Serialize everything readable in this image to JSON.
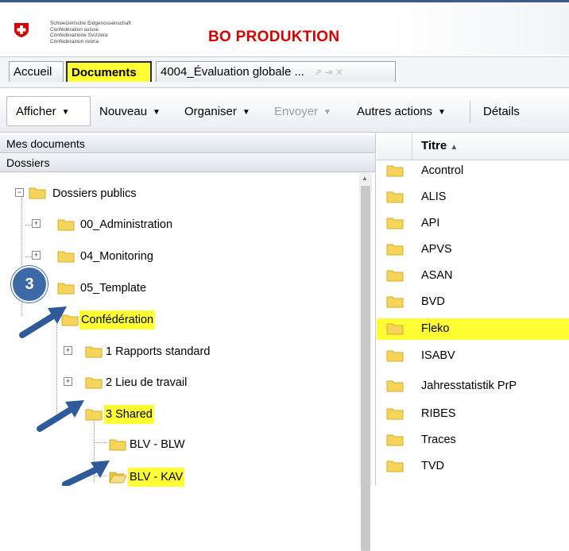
{
  "header": {
    "confederation_lines": [
      "Schweizerische Eidgenossenschaft",
      "Confédération suisse",
      "Confederazione Svizzera",
      "Confederaziun svizra"
    ],
    "app_title": "BO PRODUKTION"
  },
  "tabs": {
    "accueil": "Accueil",
    "documents": "Documents",
    "document_open": "4004_Évaluation globale ...",
    "ctrl_icons": "⇗  ⇥  ✕"
  },
  "toolbar": {
    "afficher": "Afficher",
    "nouveau": "Nouveau",
    "organiser": "Organiser",
    "envoyer": "Envoyer",
    "autres_actions": "Autres actions",
    "details": "Détails",
    "caret": "▼"
  },
  "left_panel": {
    "mes_documents": "Mes documents",
    "dossiers": "Dossiers",
    "tree": [
      {
        "label": "Dossiers publics",
        "expander": "−"
      },
      {
        "label": "00_Administration",
        "expander": "+"
      },
      {
        "label": "04_Monitoring",
        "expander": "+"
      },
      {
        "label": "05_Template",
        "expander": "+"
      },
      {
        "label": "Confédération",
        "expander": "−",
        "highlighted": true
      },
      {
        "label": "1 Rapports standard",
        "expander": "+"
      },
      {
        "label": "2 Lieu de travail",
        "expander": "+"
      },
      {
        "label": "3 Shared",
        "expander": "−",
        "highlighted": true
      },
      {
        "label": "BLV - BLW"
      },
      {
        "label": "BLV - KAV",
        "highlighted": true,
        "open": true
      }
    ],
    "step_badge": "3"
  },
  "right_panel": {
    "column_title": "Titre",
    "sort_indicator": "▲",
    "rows": [
      {
        "label": "Acontrol"
      },
      {
        "label": "ALIS"
      },
      {
        "label": "API"
      },
      {
        "label": "APVS"
      },
      {
        "label": "ASAN"
      },
      {
        "label": "BVD"
      },
      {
        "label": "Fleko",
        "highlighted": true
      },
      {
        "label": "ISABV"
      },
      {
        "label": "Jahresstatistik PrP"
      },
      {
        "label": "RIBES"
      },
      {
        "label": "Traces"
      },
      {
        "label": "TVD"
      }
    ]
  },
  "colors": {
    "highlight": "#ffff33",
    "brand_red": "#d40000",
    "badge_blue": "#3d6aa6",
    "folder_yellow": "#f5d45a"
  }
}
